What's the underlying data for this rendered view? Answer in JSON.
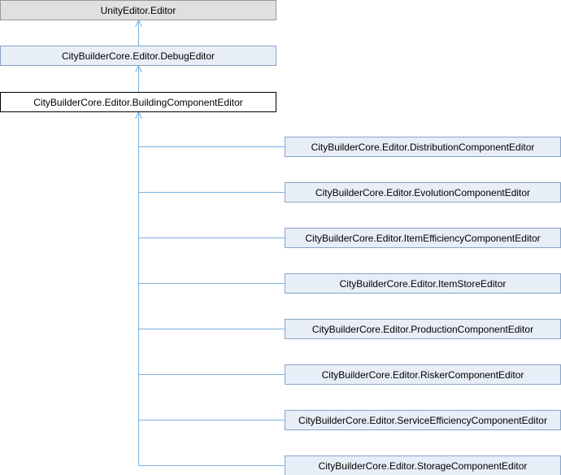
{
  "colors": {
    "edge": "#7ab0e0",
    "root_fill": "#e0e0e0",
    "root_stroke": "#999999",
    "node_fill": "#e8eef7",
    "node_stroke": "#8aa3c8",
    "current_fill": "#ffffff",
    "current_stroke": "#000000"
  },
  "nodes": {
    "root": {
      "label": "UnityEditor.Editor"
    },
    "debug_editor": {
      "label": "CityBuilderCore.Editor.DebugEditor"
    },
    "building_component_editor": {
      "label": "CityBuilderCore.Editor.BuildingComponentEditor"
    },
    "children": [
      {
        "label": "CityBuilderCore.Editor.DistributionComponentEditor"
      },
      {
        "label": "CityBuilderCore.Editor.EvolutionComponentEditor"
      },
      {
        "label": "CityBuilderCore.Editor.ItemEfficiencyComponentEditor"
      },
      {
        "label": "CityBuilderCore.Editor.ItemStoreEditor"
      },
      {
        "label": "CityBuilderCore.Editor.ProductionComponentEditor"
      },
      {
        "label": "CityBuilderCore.Editor.RiskerComponentEditor"
      },
      {
        "label": "CityBuilderCore.Editor.ServiceEfficiencyComponentEditor"
      },
      {
        "label": "CityBuilderCore.Editor.StorageComponentEditor"
      }
    ]
  }
}
